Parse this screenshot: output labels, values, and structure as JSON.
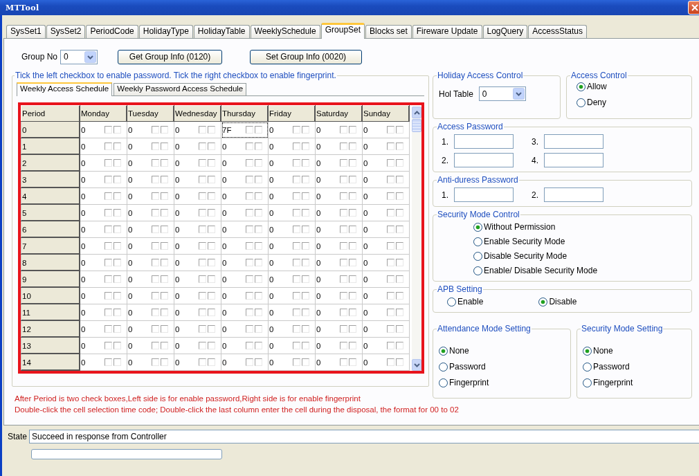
{
  "window": {
    "title": "MTTool"
  },
  "tabs": [
    {
      "label": "SysSet1",
      "selected": false
    },
    {
      "label": "SysSet2",
      "selected": false
    },
    {
      "label": "PeriodCode",
      "selected": false
    },
    {
      "label": "HolidayType",
      "selected": false
    },
    {
      "label": "HolidayTable",
      "selected": false
    },
    {
      "label": "WeeklySchedule",
      "selected": false
    },
    {
      "label": "GroupSet",
      "selected": true
    },
    {
      "label": "Blocks set",
      "selected": false
    },
    {
      "label": "Fireware Update",
      "selected": false
    },
    {
      "label": "LogQuery",
      "selected": false
    },
    {
      "label": "AccessStatus",
      "selected": false
    }
  ],
  "group_no": {
    "label": "Group No",
    "value": "0"
  },
  "buttons": [
    {
      "label": "Get Group Info (0120)"
    },
    {
      "label": "Set Group Info (0020)"
    }
  ],
  "schedule": {
    "title": "Tick the left checkbox to enable password. Tick the right checkbox to enable fingerprint.",
    "tabs": [
      {
        "label": "Weekly Access Schedule",
        "selected": true
      },
      {
        "label": "Weekly Password Access Schedule",
        "selected": false
      }
    ],
    "columns": [
      "Period",
      "Monday",
      "Tuesday",
      "Wednesday",
      "Thursday",
      "Friday",
      "Saturday",
      "Sunday"
    ],
    "rows": [
      {
        "cells": [
          {
            "kind": "period",
            "value": "0"
          },
          {
            "kind": "schedule",
            "value": "0",
            "password": false,
            "fingerprint": false,
            "selected": false
          },
          {
            "kind": "schedule",
            "value": "0",
            "password": false,
            "fingerprint": false,
            "selected": false
          },
          {
            "kind": "schedule",
            "value": "0",
            "password": false,
            "fingerprint": false,
            "selected": false
          },
          {
            "kind": "schedule",
            "value": "7F",
            "password": false,
            "fingerprint": false,
            "selected": true
          },
          {
            "kind": "schedule",
            "value": "0",
            "password": false,
            "fingerprint": false,
            "selected": false
          },
          {
            "kind": "schedule",
            "value": "0",
            "password": false,
            "fingerprint": false,
            "selected": false
          },
          {
            "kind": "schedule",
            "value": "0",
            "password": false,
            "fingerprint": false,
            "selected": false
          }
        ]
      },
      {
        "cells": [
          {
            "kind": "period",
            "value": "1"
          },
          {
            "kind": "schedule",
            "value": "0",
            "password": false,
            "fingerprint": false,
            "selected": false
          },
          {
            "kind": "schedule",
            "value": "0",
            "password": false,
            "fingerprint": false,
            "selected": false
          },
          {
            "kind": "schedule",
            "value": "0",
            "password": false,
            "fingerprint": false,
            "selected": false
          },
          {
            "kind": "schedule",
            "value": "0",
            "password": false,
            "fingerprint": false,
            "selected": false
          },
          {
            "kind": "schedule",
            "value": "0",
            "password": false,
            "fingerprint": false,
            "selected": false
          },
          {
            "kind": "schedule",
            "value": "0",
            "password": false,
            "fingerprint": false,
            "selected": false
          },
          {
            "kind": "schedule",
            "value": "0",
            "password": false,
            "fingerprint": false,
            "selected": false
          }
        ]
      },
      {
        "cells": [
          {
            "kind": "period",
            "value": "2"
          },
          {
            "kind": "schedule",
            "value": "0",
            "password": false,
            "fingerprint": false,
            "selected": false
          },
          {
            "kind": "schedule",
            "value": "0",
            "password": false,
            "fingerprint": false,
            "selected": false
          },
          {
            "kind": "schedule",
            "value": "0",
            "password": false,
            "fingerprint": false,
            "selected": false
          },
          {
            "kind": "schedule",
            "value": "0",
            "password": false,
            "fingerprint": false,
            "selected": false
          },
          {
            "kind": "schedule",
            "value": "0",
            "password": false,
            "fingerprint": false,
            "selected": false
          },
          {
            "kind": "schedule",
            "value": "0",
            "password": false,
            "fingerprint": false,
            "selected": false
          },
          {
            "kind": "schedule",
            "value": "0",
            "password": false,
            "fingerprint": false,
            "selected": false
          }
        ]
      },
      {
        "cells": [
          {
            "kind": "period",
            "value": "3"
          },
          {
            "kind": "schedule",
            "value": "0",
            "password": false,
            "fingerprint": false,
            "selected": false
          },
          {
            "kind": "schedule",
            "value": "0",
            "password": false,
            "fingerprint": false,
            "selected": false
          },
          {
            "kind": "schedule",
            "value": "0",
            "password": false,
            "fingerprint": false,
            "selected": false
          },
          {
            "kind": "schedule",
            "value": "0",
            "password": false,
            "fingerprint": false,
            "selected": false
          },
          {
            "kind": "schedule",
            "value": "0",
            "password": false,
            "fingerprint": false,
            "selected": false
          },
          {
            "kind": "schedule",
            "value": "0",
            "password": false,
            "fingerprint": false,
            "selected": false
          },
          {
            "kind": "schedule",
            "value": "0",
            "password": false,
            "fingerprint": false,
            "selected": false
          }
        ]
      },
      {
        "cells": [
          {
            "kind": "period",
            "value": "4"
          },
          {
            "kind": "schedule",
            "value": "0",
            "password": false,
            "fingerprint": false,
            "selected": false
          },
          {
            "kind": "schedule",
            "value": "0",
            "password": false,
            "fingerprint": false,
            "selected": false
          },
          {
            "kind": "schedule",
            "value": "0",
            "password": false,
            "fingerprint": false,
            "selected": false
          },
          {
            "kind": "schedule",
            "value": "0",
            "password": false,
            "fingerprint": false,
            "selected": false
          },
          {
            "kind": "schedule",
            "value": "0",
            "password": false,
            "fingerprint": false,
            "selected": false
          },
          {
            "kind": "schedule",
            "value": "0",
            "password": false,
            "fingerprint": false,
            "selected": false
          },
          {
            "kind": "schedule",
            "value": "0",
            "password": false,
            "fingerprint": false,
            "selected": false
          }
        ]
      },
      {
        "cells": [
          {
            "kind": "period",
            "value": "5"
          },
          {
            "kind": "schedule",
            "value": "0",
            "password": false,
            "fingerprint": false,
            "selected": false
          },
          {
            "kind": "schedule",
            "value": "0",
            "password": false,
            "fingerprint": false,
            "selected": false
          },
          {
            "kind": "schedule",
            "value": "0",
            "password": false,
            "fingerprint": false,
            "selected": false
          },
          {
            "kind": "schedule",
            "value": "0",
            "password": false,
            "fingerprint": false,
            "selected": false
          },
          {
            "kind": "schedule",
            "value": "0",
            "password": false,
            "fingerprint": false,
            "selected": false
          },
          {
            "kind": "schedule",
            "value": "0",
            "password": false,
            "fingerprint": false,
            "selected": false
          },
          {
            "kind": "schedule",
            "value": "0",
            "password": false,
            "fingerprint": false,
            "selected": false
          }
        ]
      },
      {
        "cells": [
          {
            "kind": "period",
            "value": "6"
          },
          {
            "kind": "schedule",
            "value": "0",
            "password": false,
            "fingerprint": false,
            "selected": false
          },
          {
            "kind": "schedule",
            "value": "0",
            "password": false,
            "fingerprint": false,
            "selected": false
          },
          {
            "kind": "schedule",
            "value": "0",
            "password": false,
            "fingerprint": false,
            "selected": false
          },
          {
            "kind": "schedule",
            "value": "0",
            "password": false,
            "fingerprint": false,
            "selected": false
          },
          {
            "kind": "schedule",
            "value": "0",
            "password": false,
            "fingerprint": false,
            "selected": false
          },
          {
            "kind": "schedule",
            "value": "0",
            "password": false,
            "fingerprint": false,
            "selected": false
          },
          {
            "kind": "schedule",
            "value": "0",
            "password": false,
            "fingerprint": false,
            "selected": false
          }
        ]
      },
      {
        "cells": [
          {
            "kind": "period",
            "value": "7"
          },
          {
            "kind": "schedule",
            "value": "0",
            "password": false,
            "fingerprint": false,
            "selected": false
          },
          {
            "kind": "schedule",
            "value": "0",
            "password": false,
            "fingerprint": false,
            "selected": false
          },
          {
            "kind": "schedule",
            "value": "0",
            "password": false,
            "fingerprint": false,
            "selected": false
          },
          {
            "kind": "schedule",
            "value": "0",
            "password": false,
            "fingerprint": false,
            "selected": false
          },
          {
            "kind": "schedule",
            "value": "0",
            "password": false,
            "fingerprint": false,
            "selected": false
          },
          {
            "kind": "schedule",
            "value": "0",
            "password": false,
            "fingerprint": false,
            "selected": false
          },
          {
            "kind": "schedule",
            "value": "0",
            "password": false,
            "fingerprint": false,
            "selected": false
          }
        ]
      },
      {
        "cells": [
          {
            "kind": "period",
            "value": "8"
          },
          {
            "kind": "schedule",
            "value": "0",
            "password": false,
            "fingerprint": false,
            "selected": false
          },
          {
            "kind": "schedule",
            "value": "0",
            "password": false,
            "fingerprint": false,
            "selected": false
          },
          {
            "kind": "schedule",
            "value": "0",
            "password": false,
            "fingerprint": false,
            "selected": false
          },
          {
            "kind": "schedule",
            "value": "0",
            "password": false,
            "fingerprint": false,
            "selected": false
          },
          {
            "kind": "schedule",
            "value": "0",
            "password": false,
            "fingerprint": false,
            "selected": false
          },
          {
            "kind": "schedule",
            "value": "0",
            "password": false,
            "fingerprint": false,
            "selected": false
          },
          {
            "kind": "schedule",
            "value": "0",
            "password": false,
            "fingerprint": false,
            "selected": false
          }
        ]
      },
      {
        "cells": [
          {
            "kind": "period",
            "value": "9"
          },
          {
            "kind": "schedule",
            "value": "0",
            "password": false,
            "fingerprint": false,
            "selected": false
          },
          {
            "kind": "schedule",
            "value": "0",
            "password": false,
            "fingerprint": false,
            "selected": false
          },
          {
            "kind": "schedule",
            "value": "0",
            "password": false,
            "fingerprint": false,
            "selected": false
          },
          {
            "kind": "schedule",
            "value": "0",
            "password": false,
            "fingerprint": false,
            "selected": false
          },
          {
            "kind": "schedule",
            "value": "0",
            "password": false,
            "fingerprint": false,
            "selected": false
          },
          {
            "kind": "schedule",
            "value": "0",
            "password": false,
            "fingerprint": false,
            "selected": false
          },
          {
            "kind": "schedule",
            "value": "0",
            "password": false,
            "fingerprint": false,
            "selected": false
          }
        ]
      },
      {
        "cells": [
          {
            "kind": "period",
            "value": "10"
          },
          {
            "kind": "schedule",
            "value": "0",
            "password": false,
            "fingerprint": false,
            "selected": false
          },
          {
            "kind": "schedule",
            "value": "0",
            "password": false,
            "fingerprint": false,
            "selected": false
          },
          {
            "kind": "schedule",
            "value": "0",
            "password": false,
            "fingerprint": false,
            "selected": false
          },
          {
            "kind": "schedule",
            "value": "0",
            "password": false,
            "fingerprint": false,
            "selected": false
          },
          {
            "kind": "schedule",
            "value": "0",
            "password": false,
            "fingerprint": false,
            "selected": false
          },
          {
            "kind": "schedule",
            "value": "0",
            "password": false,
            "fingerprint": false,
            "selected": false
          },
          {
            "kind": "schedule",
            "value": "0",
            "password": false,
            "fingerprint": false,
            "selected": false
          }
        ]
      },
      {
        "cells": [
          {
            "kind": "period",
            "value": "11"
          },
          {
            "kind": "schedule",
            "value": "0",
            "password": false,
            "fingerprint": false,
            "selected": false
          },
          {
            "kind": "schedule",
            "value": "0",
            "password": false,
            "fingerprint": false,
            "selected": false
          },
          {
            "kind": "schedule",
            "value": "0",
            "password": false,
            "fingerprint": false,
            "selected": false
          },
          {
            "kind": "schedule",
            "value": "0",
            "password": false,
            "fingerprint": false,
            "selected": false
          },
          {
            "kind": "schedule",
            "value": "0",
            "password": false,
            "fingerprint": false,
            "selected": false
          },
          {
            "kind": "schedule",
            "value": "0",
            "password": false,
            "fingerprint": false,
            "selected": false
          },
          {
            "kind": "schedule",
            "value": "0",
            "password": false,
            "fingerprint": false,
            "selected": false
          }
        ]
      },
      {
        "cells": [
          {
            "kind": "period",
            "value": "12"
          },
          {
            "kind": "schedule",
            "value": "0",
            "password": false,
            "fingerprint": false,
            "selected": false
          },
          {
            "kind": "schedule",
            "value": "0",
            "password": false,
            "fingerprint": false,
            "selected": false
          },
          {
            "kind": "schedule",
            "value": "0",
            "password": false,
            "fingerprint": false,
            "selected": false
          },
          {
            "kind": "schedule",
            "value": "0",
            "password": false,
            "fingerprint": false,
            "selected": false
          },
          {
            "kind": "schedule",
            "value": "0",
            "password": false,
            "fingerprint": false,
            "selected": false
          },
          {
            "kind": "schedule",
            "value": "0",
            "password": false,
            "fingerprint": false,
            "selected": false
          },
          {
            "kind": "schedule",
            "value": "0",
            "password": false,
            "fingerprint": false,
            "selected": false
          }
        ]
      },
      {
        "cells": [
          {
            "kind": "period",
            "value": "13"
          },
          {
            "kind": "schedule",
            "value": "0",
            "password": false,
            "fingerprint": false,
            "selected": false
          },
          {
            "kind": "schedule",
            "value": "0",
            "password": false,
            "fingerprint": false,
            "selected": false
          },
          {
            "kind": "schedule",
            "value": "0",
            "password": false,
            "fingerprint": false,
            "selected": false
          },
          {
            "kind": "schedule",
            "value": "0",
            "password": false,
            "fingerprint": false,
            "selected": false
          },
          {
            "kind": "schedule",
            "value": "0",
            "password": false,
            "fingerprint": false,
            "selected": false
          },
          {
            "kind": "schedule",
            "value": "0",
            "password": false,
            "fingerprint": false,
            "selected": false
          },
          {
            "kind": "schedule",
            "value": "0",
            "password": false,
            "fingerprint": false,
            "selected": false
          }
        ]
      },
      {
        "cells": [
          {
            "kind": "period",
            "value": "14"
          },
          {
            "kind": "schedule",
            "value": "0",
            "password": false,
            "fingerprint": false,
            "selected": false
          },
          {
            "kind": "schedule",
            "value": "0",
            "password": false,
            "fingerprint": false,
            "selected": false
          },
          {
            "kind": "schedule",
            "value": "0",
            "password": false,
            "fingerprint": false,
            "selected": false
          },
          {
            "kind": "schedule",
            "value": "0",
            "password": false,
            "fingerprint": false,
            "selected": false
          },
          {
            "kind": "schedule",
            "value": "0",
            "password": false,
            "fingerprint": false,
            "selected": false
          },
          {
            "kind": "schedule",
            "value": "0",
            "password": false,
            "fingerprint": false,
            "selected": false
          },
          {
            "kind": "schedule",
            "value": "0",
            "password": false,
            "fingerprint": false,
            "selected": false
          }
        ]
      }
    ]
  },
  "notes": [
    "After Period is two check boxes,Left side is for enable password,Right side is for enable fingerprint",
    "Double-click the cell selection time code; Double-click the last column enter the cell during the disposal, the format for 00 to 02"
  ],
  "holiday_access_control": {
    "title": "Holiday Access Control",
    "label": "Hol Table",
    "value": "0"
  },
  "access_control": {
    "title": "Access Control",
    "options": [
      {
        "label": "Allow",
        "selected": true
      },
      {
        "label": "Deny",
        "selected": false
      }
    ]
  },
  "access_password": {
    "title": "Access Password",
    "fields": [
      {
        "label": "1."
      },
      {
        "label": "3."
      },
      {
        "label": "2."
      },
      {
        "label": "4."
      }
    ]
  },
  "anti_duress_password": {
    "title": "Anti-duress Password",
    "fields": [
      {
        "label": "1."
      },
      {
        "label": "2."
      }
    ]
  },
  "security_mode_control": {
    "title": "Security Mode Control",
    "options": [
      {
        "label": "Without Permission",
        "selected": true
      },
      {
        "label": "Enable Security Mode",
        "selected": false
      },
      {
        "label": "Disable Security Mode",
        "selected": false
      },
      {
        "label": "Enable/ Disable Security Mode",
        "selected": false
      }
    ]
  },
  "apb_setting": {
    "title": "APB Setting",
    "options": [
      {
        "label": "Enable",
        "selected": false
      },
      {
        "label": "Disable",
        "selected": true
      }
    ]
  },
  "attendance_mode_setting": {
    "title": "Attendance Mode Setting",
    "options": [
      {
        "label": "None",
        "selected": true
      },
      {
        "label": "Password",
        "selected": false
      },
      {
        "label": "Fingerprint",
        "selected": false
      }
    ]
  },
  "security_mode_setting": {
    "title": "Security Mode Setting",
    "options": [
      {
        "label": "None",
        "selected": true
      },
      {
        "label": "Password",
        "selected": false
      },
      {
        "label": "Fingerprint",
        "selected": false
      }
    ]
  },
  "status": {
    "label": "State",
    "value": "Succeed in response from Controller",
    "progress": {
      "level": 0
    }
  }
}
